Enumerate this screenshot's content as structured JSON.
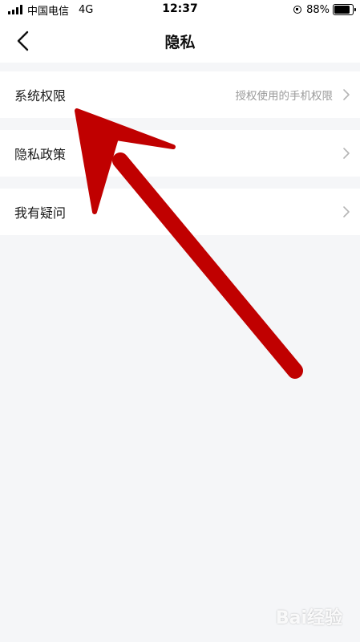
{
  "status_bar": {
    "carrier": "中国电信",
    "network": "4G",
    "time": "12:37",
    "battery": "88%",
    "battery_level": 0.88
  },
  "nav": {
    "title": "隐私",
    "back_icon": "chevron-left-icon"
  },
  "items": [
    {
      "label": "系统权限",
      "desc": "授权使用的手机权限"
    },
    {
      "label": "隐私政策",
      "desc": ""
    },
    {
      "label": "我有疑问",
      "desc": ""
    }
  ],
  "annotation": {
    "arrow_color": "#c00000"
  },
  "watermark": "Bai经验"
}
